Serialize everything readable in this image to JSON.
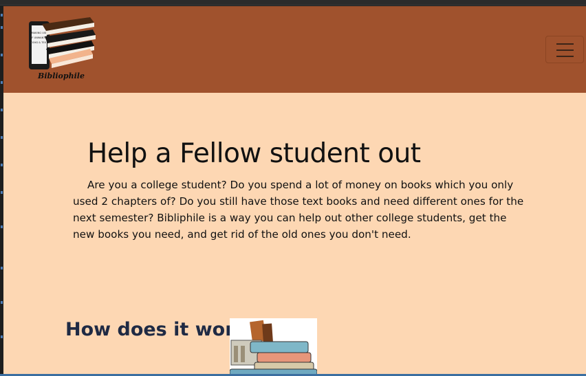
{
  "navbar": {
    "logo_text": "Bibliophile",
    "logo_screen_text": "MAKING USE OF UNWANTED BOOKS & TEXTS",
    "toggler_icon": "hamburger-menu-icon",
    "background_color": "#a0522d"
  },
  "hero": {
    "title": "Help a Fellow student out",
    "paragraph": "Are you a college student? Do you spend a lot of money on books which you only used 2 chapters of? Do you still have those text books and need different ones for the next semester? Bibliphile is a way you can help out other college students, get the new books you need, and get rid of the old ones you don't need."
  },
  "how_section": {
    "title": "How does it work?",
    "image_icon": "stack-of-books-illustration"
  },
  "colors": {
    "page_background": "#fdd7b3",
    "navbar": "#a0522d",
    "text": "#111111"
  }
}
